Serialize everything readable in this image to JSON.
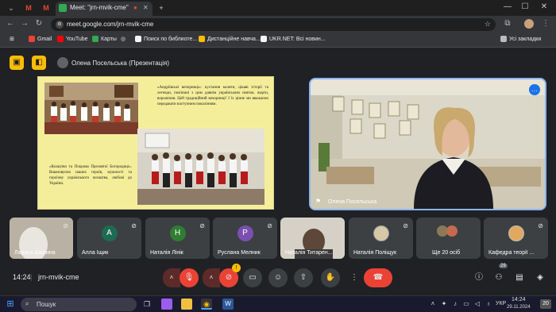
{
  "browser": {
    "tab_title": "Meet: \"jrn-mvik-cme\"",
    "url": "meet.google.com/jrn-mvik-cme",
    "new_tab": "+",
    "bookmarks": [
      {
        "label": "Gmail",
        "color": "#ea4335"
      },
      {
        "label": "YouTube",
        "color": "#ff0000"
      },
      {
        "label": "Карты",
        "color": "#34a853"
      },
      {
        "label": "Поиск по библиоте...",
        "color": "#f5f5f5"
      },
      {
        "label": "Дистанційне навча...",
        "color": "#fbbc04"
      },
      {
        "label": "UKR.NET: Всі новин...",
        "color": "#f5f5f5"
      }
    ],
    "bookmarks_all": "Усі закладки"
  },
  "meet": {
    "presenter_label": "Олена Посельська (Презентація)",
    "slide": {
      "text_right": "«Андріївські вечорниці»: кустання калити, цікаві історії та легенди, пов'язані з цим давнім українським святом, жарти, ворожіння. Цей традиційний вечорниці! І їх цінне ми вважаємо передавати наступним поколінням.",
      "text_left": "«Козацтво та Покрова Пресвятої Богородиці». Вшановуємо наших героїв, мужності та героїзму українського козацтва, любові до України."
    },
    "speaker_name": "Олена Посельська",
    "participants": [
      {
        "name": "Лариса Шалина",
        "initial": "",
        "color": "#888"
      },
      {
        "name": "Алла Іщик",
        "initial": "A",
        "color": "#1e6b52"
      },
      {
        "name": "Наталія Лінік",
        "initial": "H",
        "color": "#2e7d32"
      },
      {
        "name": "Руслана Мелник",
        "initial": "P",
        "color": "#7b4fb0"
      },
      {
        "name": "Наталія Титарен...",
        "initial": "",
        "color": "#666"
      },
      {
        "name": "Наталія Поліщук",
        "initial": "",
        "color": "#777"
      },
      {
        "name": "Ще 20 осіб",
        "initial": "",
        "color": "#555"
      },
      {
        "name": "Кафедра теорії ...",
        "initial": "",
        "color": "#999"
      }
    ],
    "time": "14:24",
    "meeting_code": "jrn-mvik-cme",
    "badge_count": "29",
    "video_badge": "!"
  },
  "taskbar": {
    "search_label": "Пошук",
    "lang": "УКР",
    "clock_time": "14:24",
    "clock_date": "29.11.2024",
    "notif": "20"
  }
}
